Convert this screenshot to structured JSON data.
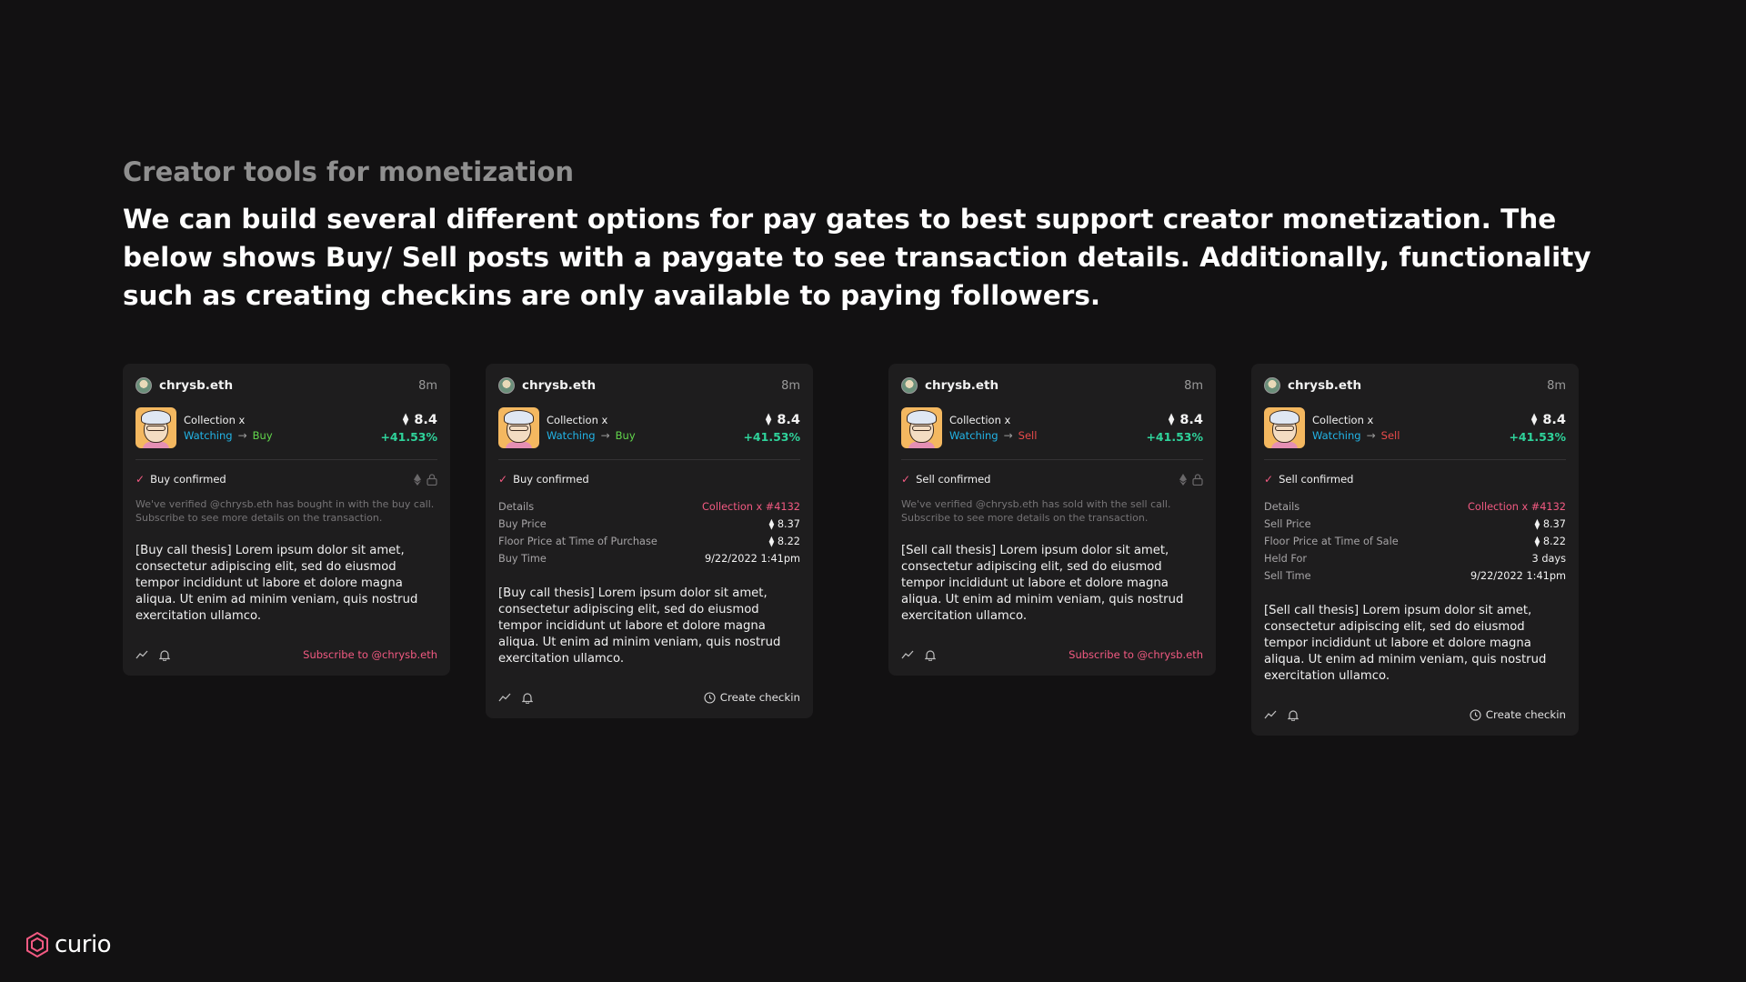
{
  "page": {
    "subtitle": "Creator tools for monetization",
    "headline": "We can build several different options for pay gates to best support creator monetization. The below shows Buy/ Sell posts with a paygate to see transaction details. Additionally, functionality such as creating checkins are only available to paying followers."
  },
  "colors": {
    "accent_pink": "#f35a82",
    "watching_blue": "#22b4e6",
    "buy_green": "#62d64c",
    "sell_red": "#ea4b4b",
    "gain_green": "#2fd39b"
  },
  "cards": [
    {
      "username": "chrysb.eth",
      "time": "8m",
      "collection": "Collection x",
      "watching": "Watching",
      "action": "Buy",
      "price": "8.4",
      "change": "+41.53%",
      "confirm": "Buy confirmed",
      "notice": "We've verified @chrysb.eth has bought in with the buy call. Subscribe to see more details on the transaction.",
      "thesis": "[Buy call thesis] Lorem ipsum dolor sit amet, consectetur adipiscing elit, sed do eiusmod tempor incididunt ut labore et dolore magna aliqua. Ut enim ad minim veniam, quis nostrud exercitation ullamco.",
      "footer_action": "Subscribe to @chrysb.eth"
    },
    {
      "username": "chrysb.eth",
      "time": "8m",
      "collection": "Collection x",
      "watching": "Watching",
      "action": "Buy",
      "price": "8.4",
      "change": "+41.53%",
      "confirm": "Buy confirmed",
      "details": [
        {
          "label": "Details",
          "value": "Collection x #4132"
        },
        {
          "label": "Buy Price",
          "value": "8.37"
        },
        {
          "label": "Floor Price at Time of Purchase",
          "value": "8.22"
        },
        {
          "label": "Buy Time",
          "value": "9/22/2022 1:41pm"
        }
      ],
      "thesis": "[Buy call thesis] Lorem ipsum dolor sit amet, consectetur adipiscing elit, sed do eiusmod tempor incididunt ut labore et dolore magna aliqua. Ut enim ad minim veniam, quis nostrud exercitation ullamco.",
      "footer_action": "Create checkin"
    },
    {
      "username": "chrysb.eth",
      "time": "8m",
      "collection": "Collection x",
      "watching": "Watching",
      "action": "Sell",
      "price": "8.4",
      "change": "+41.53%",
      "confirm": "Sell confirmed",
      "notice": "We've verified @chrysb.eth has sold with the sell call. Subscribe to see more details on the transaction.",
      "thesis": "[Sell call thesis] Lorem ipsum dolor sit amet, consectetur adipiscing elit, sed do eiusmod tempor incididunt ut labore et dolore magna aliqua. Ut enim ad minim veniam, quis nostrud exercitation ullamco.",
      "footer_action": "Subscribe to @chrysb.eth"
    },
    {
      "username": "chrysb.eth",
      "time": "8m",
      "collection": "Collection x",
      "watching": "Watching",
      "action": "Sell",
      "price": "8.4",
      "change": "+41.53%",
      "confirm": "Sell confirmed",
      "details": [
        {
          "label": "Details",
          "value": "Collection x #4132"
        },
        {
          "label": "Sell Price",
          "value": "8.37"
        },
        {
          "label": "Floor Price at Time of Sale",
          "value": "8.22"
        },
        {
          "label": "Held For",
          "value": "3 days"
        },
        {
          "label": "Sell Time",
          "value": "9/22/2022 1:41pm"
        }
      ],
      "thesis": "[Sell call thesis] Lorem ipsum dolor sit amet, consectetur adipiscing elit, sed do eiusmod tempor incididunt ut labore et dolore magna aliqua. Ut enim ad minim veniam, quis nostrud exercitation ullamco.",
      "footer_action": "Create checkin"
    }
  ],
  "logo": {
    "text": "curio",
    "icon": "curio-logo-icon"
  }
}
